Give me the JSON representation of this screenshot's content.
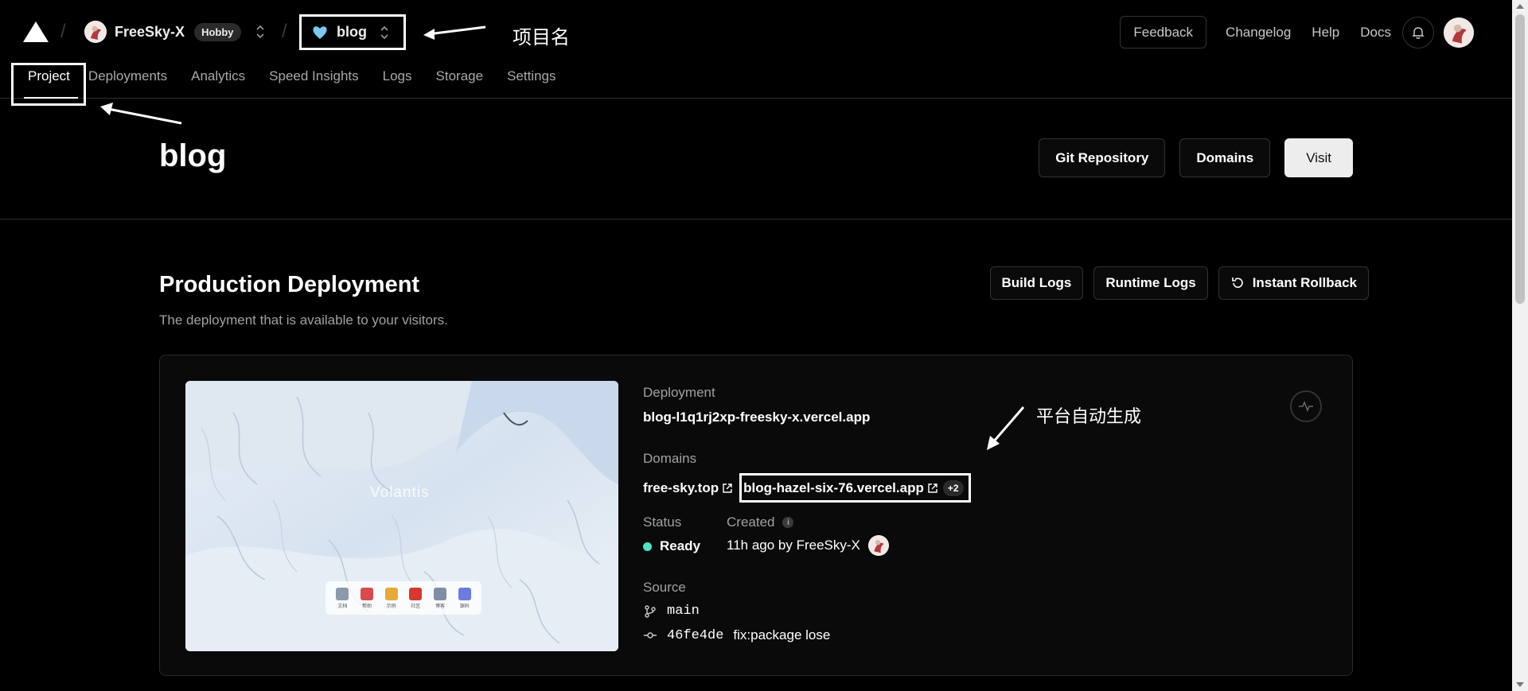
{
  "header": {
    "team_name": "FreeSky-X",
    "plan_badge": "Hobby",
    "project_name": "blog",
    "annotation_project": "项目名",
    "feedback": "Feedback",
    "links": [
      "Changelog",
      "Help",
      "Docs"
    ]
  },
  "nav": {
    "tabs": [
      "Project",
      "Deployments",
      "Analytics",
      "Speed Insights",
      "Logs",
      "Storage",
      "Settings"
    ],
    "active": "Project"
  },
  "project": {
    "title": "blog",
    "actions": [
      "Git Repository",
      "Domains",
      "Visit"
    ]
  },
  "production": {
    "title": "Production Deployment",
    "subtitle": "The deployment that is available to your visitors.",
    "actions": [
      "Build Logs",
      "Runtime Logs",
      "Instant Rollback"
    ],
    "preview": {
      "brand": "Volantis",
      "dock": [
        "文档",
        "帮助",
        "示例",
        "社区",
        "博客",
        "源码"
      ]
    },
    "deployment_label": "Deployment",
    "deployment_url": "blog-l1q1rj2xp-freesky-x.vercel.app",
    "domains_label": "Domains",
    "domain_primary": "free-sky.top",
    "domain_auto": "blog-hazel-six-76.vercel.app",
    "domain_more": "+2",
    "annotation_auto": "平台自动生成",
    "status_label": "Status",
    "status_value": "Ready",
    "created_label": "Created",
    "created_value": "11h ago by FreeSky-X",
    "source_label": "Source",
    "branch": "main",
    "commit_hash": "46fe4de",
    "commit_message": "fix:package lose"
  },
  "colors": {
    "background": "#000000",
    "ready": "#50e3c2",
    "border": "#2e2e2e"
  }
}
